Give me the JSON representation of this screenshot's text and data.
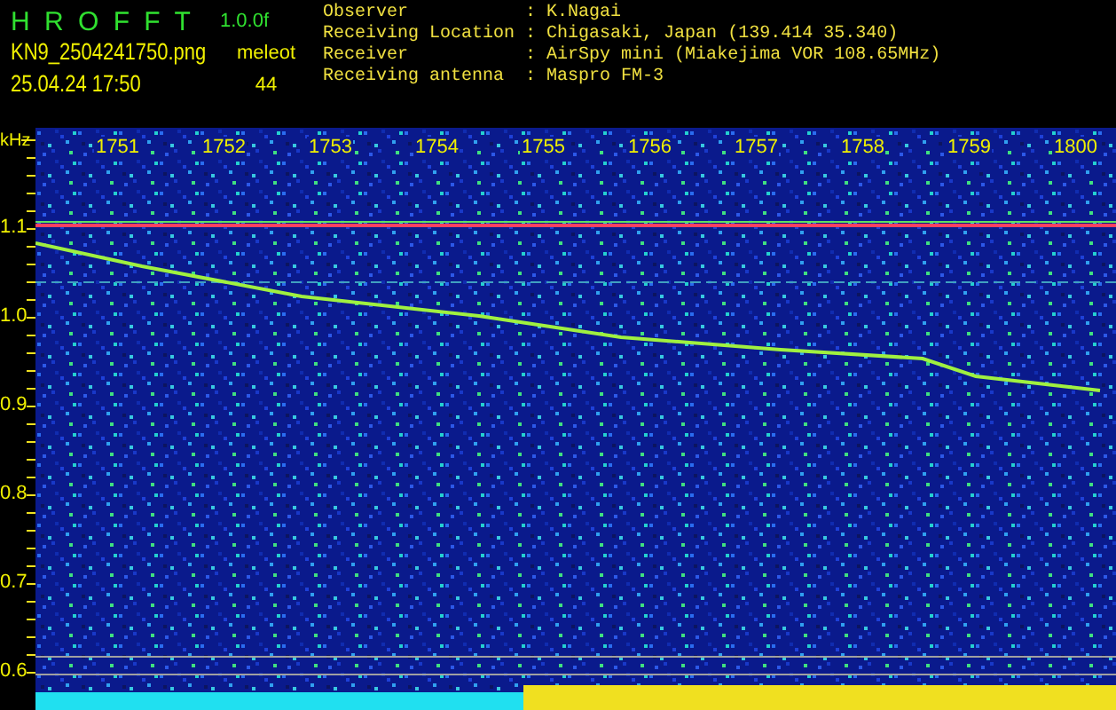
{
  "header": {
    "app_title": "H R O F F T",
    "version": "1.0.0f",
    "filename": "KN9_2504241750.png",
    "mode": "meleot",
    "datetime": "25.04.24 17:50",
    "count": "44"
  },
  "info": [
    {
      "label": "Observer",
      "separator": ":",
      "value": "K.Nagai"
    },
    {
      "label": "Receiving Location",
      "separator": ":",
      "value": "Chigasaki, Japan (139.414 35.340)"
    },
    {
      "label": "Receiver",
      "separator": ":",
      "value": "AirSpy mini (Miakejima VOR 108.65MHz)"
    },
    {
      "label": "Receiving antenna",
      "separator": ":",
      "value": "Maspro FM-3"
    }
  ],
  "spectrogram": {
    "frequency_unit": "kHz",
    "time_labels": [
      "1751",
      "1752",
      "1753",
      "1754",
      "1755",
      "1756",
      "1757",
      "1758",
      "1759",
      "1800"
    ],
    "frequency_labels": [
      "1.1",
      "1.0",
      "0.9",
      "0.8",
      "0.7",
      "0.6"
    ]
  }
}
